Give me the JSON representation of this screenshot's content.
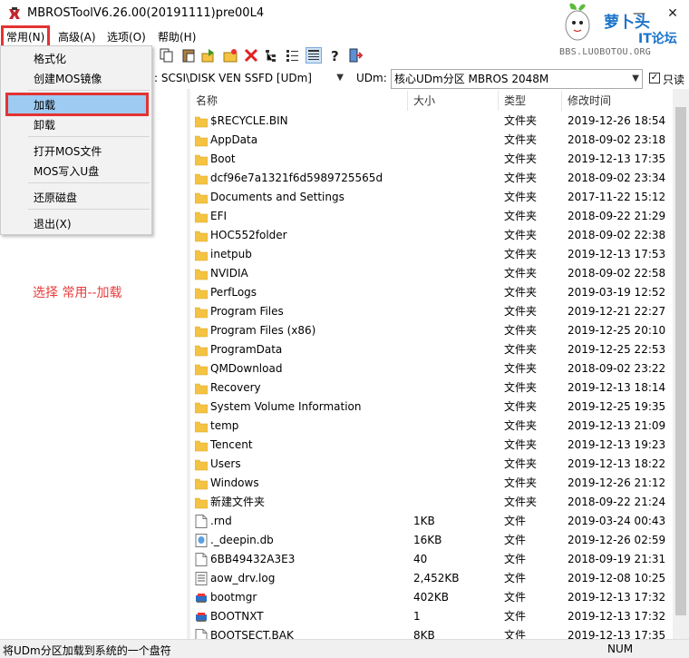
{
  "window": {
    "title": "MBROSToolV6.26.00(20191111)pre00L4",
    "minimize_glyph": "—",
    "close_glyph": "✕"
  },
  "watermark": {
    "line1": "萝卜头",
    "line2": "IT论坛",
    "url": "BBS.LUOBOTOU.ORG"
  },
  "menubar": {
    "items": [
      {
        "label": "常用(N)"
      },
      {
        "label": "高级(A)"
      },
      {
        "label": "选项(O)"
      },
      {
        "label": "帮助(H)"
      }
    ]
  },
  "dropdown": {
    "items": [
      {
        "label": "格式化"
      },
      {
        "label": "创建MOS镜像"
      },
      {
        "label": "加载"
      },
      {
        "label": "卸载"
      },
      {
        "label": "打开MOS文件"
      },
      {
        "label": "MOS写入U盘"
      },
      {
        "label": "还原磁盘"
      },
      {
        "label": "退出(X)"
      }
    ],
    "selected": "加载"
  },
  "toolbar": {
    "icons": [
      "copy-icon",
      "paste-icon",
      "move-icon",
      "new-folder-icon",
      "delete-icon",
      "tree-view-icon",
      "list-view-icon",
      "details-view-icon",
      "help-icon",
      "exit-icon"
    ]
  },
  "address": {
    "disk_combo": ": SCSI\\DISK  VEN SSFD [UDm]",
    "udm_label": "UDm:",
    "udm_combo": "核心UDm分区 MBROS 2048M",
    "readonly_label": "只读",
    "readonly_checked": true
  },
  "annotation": "选择  常用--加载",
  "file_list": {
    "columns": [
      "名称",
      "大小",
      "类型",
      "修改时间"
    ],
    "rows": [
      {
        "name": "$RECYCLE.BIN",
        "size": "",
        "type": "文件夹",
        "date": "2019-12-26 18:54",
        "icon": "folder"
      },
      {
        "name": "AppData",
        "size": "",
        "type": "文件夹",
        "date": "2018-09-02 23:18",
        "icon": "folder"
      },
      {
        "name": "Boot",
        "size": "",
        "type": "文件夹",
        "date": "2019-12-13 17:35",
        "icon": "folder"
      },
      {
        "name": "dcf96e7a1321f6d5989725565d",
        "size": "",
        "type": "文件夹",
        "date": "2018-09-02 23:34",
        "icon": "folder"
      },
      {
        "name": "Documents and Settings",
        "size": "",
        "type": "文件夹",
        "date": "2017-11-22 15:12",
        "icon": "folder"
      },
      {
        "name": "EFI",
        "size": "",
        "type": "文件夹",
        "date": "2018-09-22 21:29",
        "icon": "folder"
      },
      {
        "name": "HOC552folder",
        "size": "",
        "type": "文件夹",
        "date": "2018-09-02 22:38",
        "icon": "folder"
      },
      {
        "name": "inetpub",
        "size": "",
        "type": "文件夹",
        "date": "2019-12-13 17:53",
        "icon": "folder"
      },
      {
        "name": "NVIDIA",
        "size": "",
        "type": "文件夹",
        "date": "2018-09-02 22:58",
        "icon": "folder"
      },
      {
        "name": "PerfLogs",
        "size": "",
        "type": "文件夹",
        "date": "2019-03-19 12:52",
        "icon": "folder"
      },
      {
        "name": "Program Files",
        "size": "",
        "type": "文件夹",
        "date": "2019-12-21 22:27",
        "icon": "folder"
      },
      {
        "name": "Program Files (x86)",
        "size": "",
        "type": "文件夹",
        "date": "2019-12-25 20:10",
        "icon": "folder"
      },
      {
        "name": "ProgramData",
        "size": "",
        "type": "文件夹",
        "date": "2019-12-25 22:53",
        "icon": "folder"
      },
      {
        "name": "QMDownload",
        "size": "",
        "type": "文件夹",
        "date": "2018-09-02 23:22",
        "icon": "folder"
      },
      {
        "name": "Recovery",
        "size": "",
        "type": "文件夹",
        "date": "2019-12-13 18:14",
        "icon": "folder"
      },
      {
        "name": "System Volume Information",
        "size": "",
        "type": "文件夹",
        "date": "2019-12-25 19:35",
        "icon": "folder"
      },
      {
        "name": "temp",
        "size": "",
        "type": "文件夹",
        "date": "2019-12-13 21:09",
        "icon": "folder"
      },
      {
        "name": "Tencent",
        "size": "",
        "type": "文件夹",
        "date": "2019-12-13 19:23",
        "icon": "folder"
      },
      {
        "name": "Users",
        "size": "",
        "type": "文件夹",
        "date": "2019-12-13 18:22",
        "icon": "folder"
      },
      {
        "name": "Windows",
        "size": "",
        "type": "文件夹",
        "date": "2019-12-26 21:12",
        "icon": "folder"
      },
      {
        "name": "新建文件夹",
        "size": "",
        "type": "文件夹",
        "date": "2018-09-22 21:24",
        "icon": "folder"
      },
      {
        "name": ".rnd",
        "size": "1KB",
        "type": "文件",
        "date": "2019-03-24 00:43",
        "icon": "file"
      },
      {
        "name": "._deepin.db",
        "size": "16KB",
        "type": "文件",
        "date": "2019-12-26 02:59",
        "icon": "db"
      },
      {
        "name": "6BB49432A3E3",
        "size": "40",
        "type": "文件",
        "date": "2018-09-19 21:31",
        "icon": "file"
      },
      {
        "name": "aow_drv.log",
        "size": "2,452KB",
        "type": "文件",
        "date": "2019-12-08 10:25",
        "icon": "text"
      },
      {
        "name": "bootmgr",
        "size": "402KB",
        "type": "文件",
        "date": "2019-12-13 17:32",
        "icon": "sys"
      },
      {
        "name": "BOOTNXT",
        "size": "1",
        "type": "文件",
        "date": "2019-12-13 17:32",
        "icon": "sys"
      },
      {
        "name": "BOOTSECT.BAK",
        "size": "8KB",
        "type": "文件",
        "date": "2019-12-13 17:35",
        "icon": "file"
      }
    ]
  },
  "statusbar": {
    "text": "将UDm分区加载到系统的一个盘符",
    "num": "NUM"
  },
  "colors": {
    "highlight_border": "#e33333",
    "selection_fill": "#9ecbf2",
    "annotation": "#e83c3c",
    "folder": "#f5c342",
    "watermark_blue": "#1a73c9"
  }
}
